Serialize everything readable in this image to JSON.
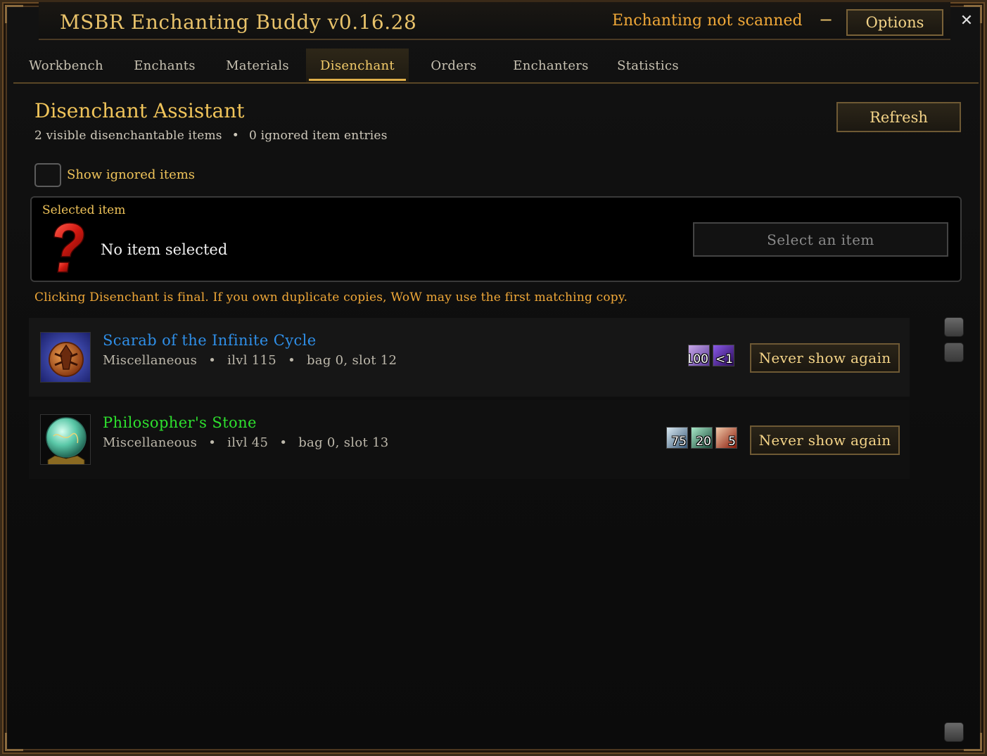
{
  "window": {
    "title": "MSBR Enchanting Buddy v0.16.28",
    "scan_status": "Enchanting not scanned",
    "minimize_label": "−",
    "options_label": "Options",
    "close_label": "✕"
  },
  "tabs": [
    {
      "label": "Workbench",
      "active": false
    },
    {
      "label": "Enchants",
      "active": false
    },
    {
      "label": "Materials",
      "active": false
    },
    {
      "label": "Disenchant",
      "active": true
    },
    {
      "label": "Orders",
      "active": false
    },
    {
      "label": "Enchanters",
      "active": false
    },
    {
      "label": "Statistics",
      "active": false
    }
  ],
  "main": {
    "title": "Disenchant Assistant",
    "visible_count": "2 visible disenchantable items",
    "separator": "•",
    "ignored_count": "0 ignored item entries",
    "refresh_label": "Refresh",
    "show_ignored_label": "Show ignored items",
    "show_ignored_checked": false
  },
  "selected": {
    "heading": "Selected item",
    "icon": "question-mark-icon",
    "empty_text": "No item selected",
    "select_button_label": "Select an item"
  },
  "warning": "Clicking Disenchant is final. If you own duplicate copies, WoW may use the first matching copy.",
  "items": [
    {
      "name": "Scarab of the Infinite Cycle",
      "quality_color": "#2f8fe8",
      "type": "Miscellaneous",
      "ilvl": "ilvl 115",
      "location": "bag 0, slot 12",
      "icon": "scarab-icon",
      "materials": [
        {
          "icon": "dust-icon",
          "count": "100"
        },
        {
          "icon": "crystal-shard-icon",
          "count": "<1"
        }
      ],
      "never_label": "Never show again"
    },
    {
      "name": "Philosopher's Stone",
      "quality_color": "#2ee02e",
      "type": "Miscellaneous",
      "ilvl": "ilvl 45",
      "location": "bag 0, slot 13",
      "icon": "orb-icon",
      "materials": [
        {
          "icon": "dust-icon",
          "count": "75"
        },
        {
          "icon": "essence-icon",
          "count": "20"
        },
        {
          "icon": "shard-icon",
          "count": "5"
        }
      ],
      "never_label": "Never show again"
    }
  ]
}
